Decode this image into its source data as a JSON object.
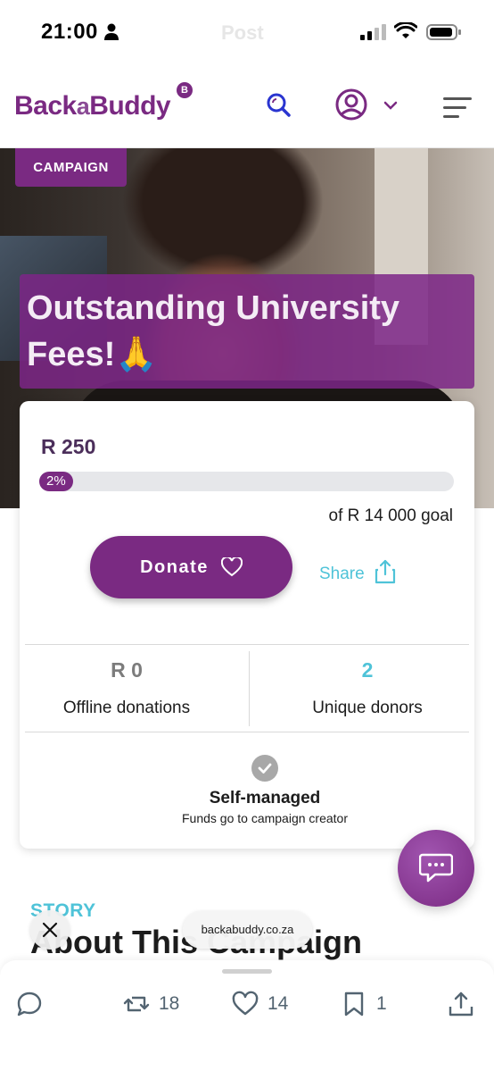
{
  "status_bar": {
    "time": "21:00",
    "center_title": "Post"
  },
  "header": {
    "logo_part1": "Back",
    "logo_part2": "a",
    "logo_part3": "Buddy",
    "logo_badge": "B",
    "brand_color": "#7a2a82",
    "accent_color": "#4fc3d8"
  },
  "hero": {
    "badge": "CAMPAIGN",
    "title": "Outstanding University Fees!🙏"
  },
  "donation": {
    "raised": "R 250",
    "progress_percent": 2,
    "progress_label": "2%",
    "goal": "of R 14 000 goal",
    "donate_label": "Donate",
    "share_label": "Share"
  },
  "stats": {
    "offline_value": "R 0",
    "offline_label": "Offline donations",
    "donors_value": "2",
    "donors_label": "Unique donors"
  },
  "management": {
    "title": "Self-managed",
    "subtitle": "Funds go to campaign creator"
  },
  "story": {
    "label": "STORY",
    "heading": "About This Campaign"
  },
  "browser": {
    "url": "backabuddy.co.za"
  },
  "bottom_bar": {
    "reply_count": "",
    "repost_count": "18",
    "like_count": "14",
    "bookmark_count": "1"
  },
  "icons": {
    "search": "search-icon",
    "user": "user-circle-icon",
    "menu": "hamburger-icon",
    "heart": "heart-icon",
    "share": "share-icon",
    "chat": "chat-icon",
    "close": "close-icon"
  }
}
